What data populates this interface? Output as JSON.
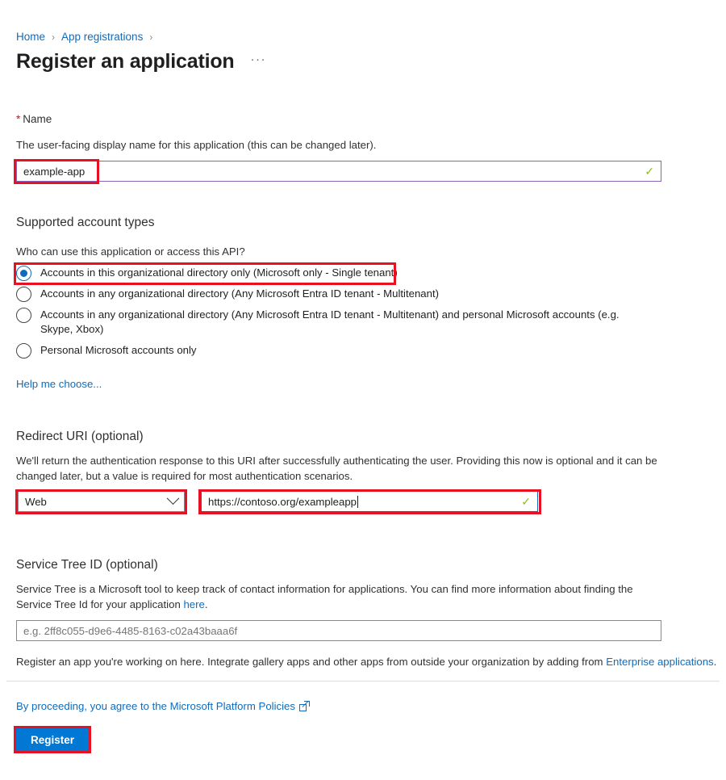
{
  "breadcrumb": {
    "items": [
      {
        "label": "Home"
      },
      {
        "label": "App registrations"
      }
    ],
    "separator": "›"
  },
  "header": {
    "title": "Register an application",
    "overflow_label": "···"
  },
  "name_section": {
    "required_star": "*",
    "label": "Name",
    "description": "The user-facing display name for this application (this can be changed later).",
    "value": "example-app",
    "valid_icon": "✓"
  },
  "account_types": {
    "heading": "Supported account types",
    "question": "Who can use this application or access this API?",
    "options": [
      {
        "label": "Accounts in this organizational directory only (Microsoft only - Single tenant)",
        "selected": true
      },
      {
        "label": "Accounts in any organizational directory (Any Microsoft Entra ID tenant - Multitenant)",
        "selected": false
      },
      {
        "label": "Accounts in any organizational directory (Any Microsoft Entra ID tenant - Multitenant) and personal Microsoft accounts (e.g. Skype, Xbox)",
        "selected": false
      },
      {
        "label": "Personal Microsoft accounts only",
        "selected": false
      }
    ],
    "help_link": "Help me choose..."
  },
  "redirect_uri": {
    "heading": "Redirect URI (optional)",
    "description": "We'll return the authentication response to this URI after successfully authenticating the user. Providing this now is optional and it can be changed later, but a value is required for most authentication scenarios.",
    "platform_value": "Web",
    "uri_value": "https://contoso.org/exampleapp",
    "valid_icon": "✓"
  },
  "service_tree": {
    "heading": "Service Tree ID (optional)",
    "description_part1": "Service Tree is a Microsoft tool to keep track of contact information for applications. You can find more information about finding the Service Tree Id for your application ",
    "description_link": "here",
    "description_part2": ".",
    "placeholder": "e.g. 2ff8c055-d9e6-4485-8163-c02a43baaa6f",
    "value": ""
  },
  "gallery_note": {
    "text_part1": "Register an app you're working on here. Integrate gallery apps and other apps from outside your organization by adding from ",
    "link": "Enterprise applications",
    "text_part2": "."
  },
  "footer": {
    "policy_text": "By proceeding, you agree to the Microsoft Platform Policies",
    "register_label": "Register"
  },
  "colors": {
    "link": "#0f6cbd",
    "primary_button": "#0078d4",
    "annotation": "#e81123",
    "input_focus_purple": "#8764b8",
    "input_focus_blue": "#0f6cbd",
    "valid_check": "#8cbd18"
  }
}
